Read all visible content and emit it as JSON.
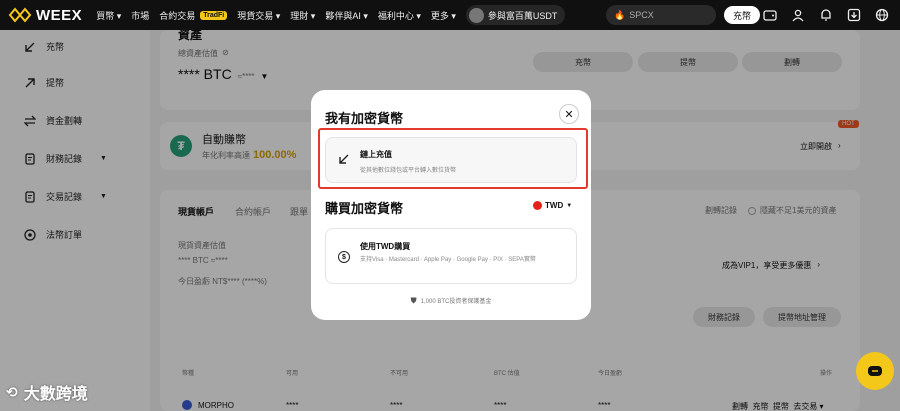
{
  "topbar": {
    "brand": "WEEX",
    "nav": [
      "買幣 ▾",
      "市場",
      "合約交易",
      "現貨交易 ▾",
      "理財 ▾",
      "夥伴與AI ▾",
      "福利中心 ▾",
      "更多 ▾"
    ],
    "tradfi_badge": "TradFi",
    "promo": "參與富百萬USDT",
    "search_placeholder": "SPCX",
    "deposit_label": "充幣"
  },
  "sidebar": {
    "items": [
      {
        "label": "充幣",
        "icon": "arrow-down-left-icon"
      },
      {
        "label": "提幣",
        "icon": "arrow-up-right-icon"
      },
      {
        "label": "資金劃轉",
        "icon": "transfer-icon"
      },
      {
        "label": "財務記錄",
        "icon": "record-icon"
      },
      {
        "label": "交易記錄",
        "icon": "record-icon"
      },
      {
        "label": "法幣訂單",
        "icon": "target-icon"
      }
    ]
  },
  "overview": {
    "heading_partial": "資產",
    "label": "總資產估值",
    "value": "**** BTC",
    "approx": "≈****",
    "buttons": [
      "充幣",
      "提幣",
      "劃轉"
    ]
  },
  "earn": {
    "title": "自動賺幣",
    "subtitle_prefix": "年化利率高達",
    "rate": "100.00%",
    "hot": "HOT",
    "cta": "立即開啟"
  },
  "accounts": {
    "tabs": [
      "現貨帳戶",
      "合約帳戶",
      "跟單"
    ],
    "transfer_record": "劃轉記錄",
    "hide_small": "隱藏不足1美元的資產",
    "spot_label": "現貨資產估值",
    "spot_value": "**** BTC ≈****",
    "pnl": "今日盈虧 NT$**** (****%)",
    "vip": "成為VIP1，享受更多優惠",
    "btn_finance": "財務記錄",
    "btn_address": "提幣地址管理",
    "columns": [
      "幣種",
      "可用",
      "不可用",
      "BTC 估值",
      "今日盈虧",
      "操作"
    ],
    "row": {
      "coin": "MORPHO",
      "v1": "****",
      "v2": "****",
      "v3": "****",
      "v4": "****",
      "actions": "劃轉  充幣  提幣  去交易 ▾"
    }
  },
  "modal": {
    "title1": "我有加密貨幣",
    "onchain_title": "鏈上充值",
    "onchain_desc": "從其他數位錢包或平台轉入數位貨幣",
    "title2": "購買加密貨幣",
    "currency": "TWD",
    "buy_title": "使用TWD購買",
    "buy_desc": "支持Visa · Mastercard · Apple Pay · Google Pay · PIX · SEPA實幣",
    "fund_note": "1,000 BTC投資者保護基金"
  },
  "watermark": "大數跨境",
  "colors": {
    "accent": "#f4c81a",
    "highlight": "#e23a2f",
    "tether": "#26a17b"
  }
}
